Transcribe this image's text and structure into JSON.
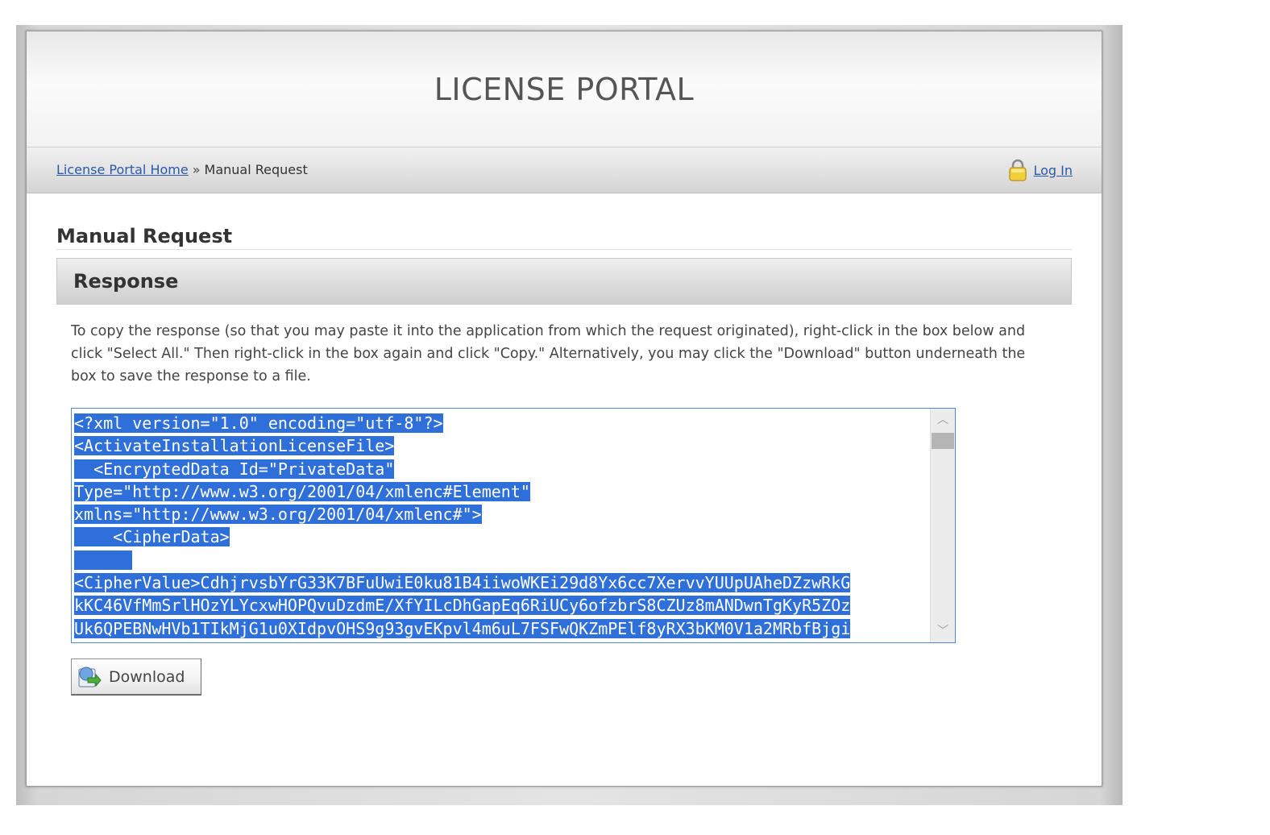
{
  "header": {
    "title": "LICENSE PORTAL"
  },
  "nav": {
    "breadcrumb_home": "License Portal Home",
    "breadcrumb_separator": "»",
    "breadcrumb_current": "Manual Request",
    "login_label": "Log In",
    "login_icon": "lock-icon"
  },
  "main": {
    "page_heading": "Manual Request",
    "section_title": "Response",
    "instructions": "To copy the response (so that you may paste it into the application from which the request originated), right-click in the box below and click \"Select All.\" Then right-click in the box again and click \"Copy.\" Alternatively, you may click the \"Download\" button underneath the box to save the response to a file.",
    "response_lines": [
      "<?xml version=\"1.0\" encoding=\"utf-8\"?>",
      "<ActivateInstallationLicenseFile>",
      "  <EncryptedData Id=\"PrivateData\"",
      "Type=\"http://www.w3.org/2001/04/xmlenc#Element\"",
      "xmlns=\"http://www.w3.org/2001/04/xmlenc#\">",
      "    <CipherData>",
      "      ",
      "<CipherValue>CdhjrvsbYrG33K7BFuUwiE0ku81B4iiwoWKEi29d8Yx6cc7XervvYUUpUAheDZzwRkG",
      "kKC46VfMmSrlHOzYLYcxwHOPQvuDzdmE/XfYILcDhGapEq6RiUCy6ofzbrS8CZUz8mANDwnTgKyR5ZOz",
      "Uk6QPEBNwHVb1TIkMjG1u0XIdpvOHS9g93gvEKpvl4m6uL7FSFwQKZmPElf8yRX3bKM0V1a2MRbfBjgi"
    ],
    "download_label": "Download",
    "download_icon": "download-icon",
    "selection_color": "#2f6fd9"
  }
}
